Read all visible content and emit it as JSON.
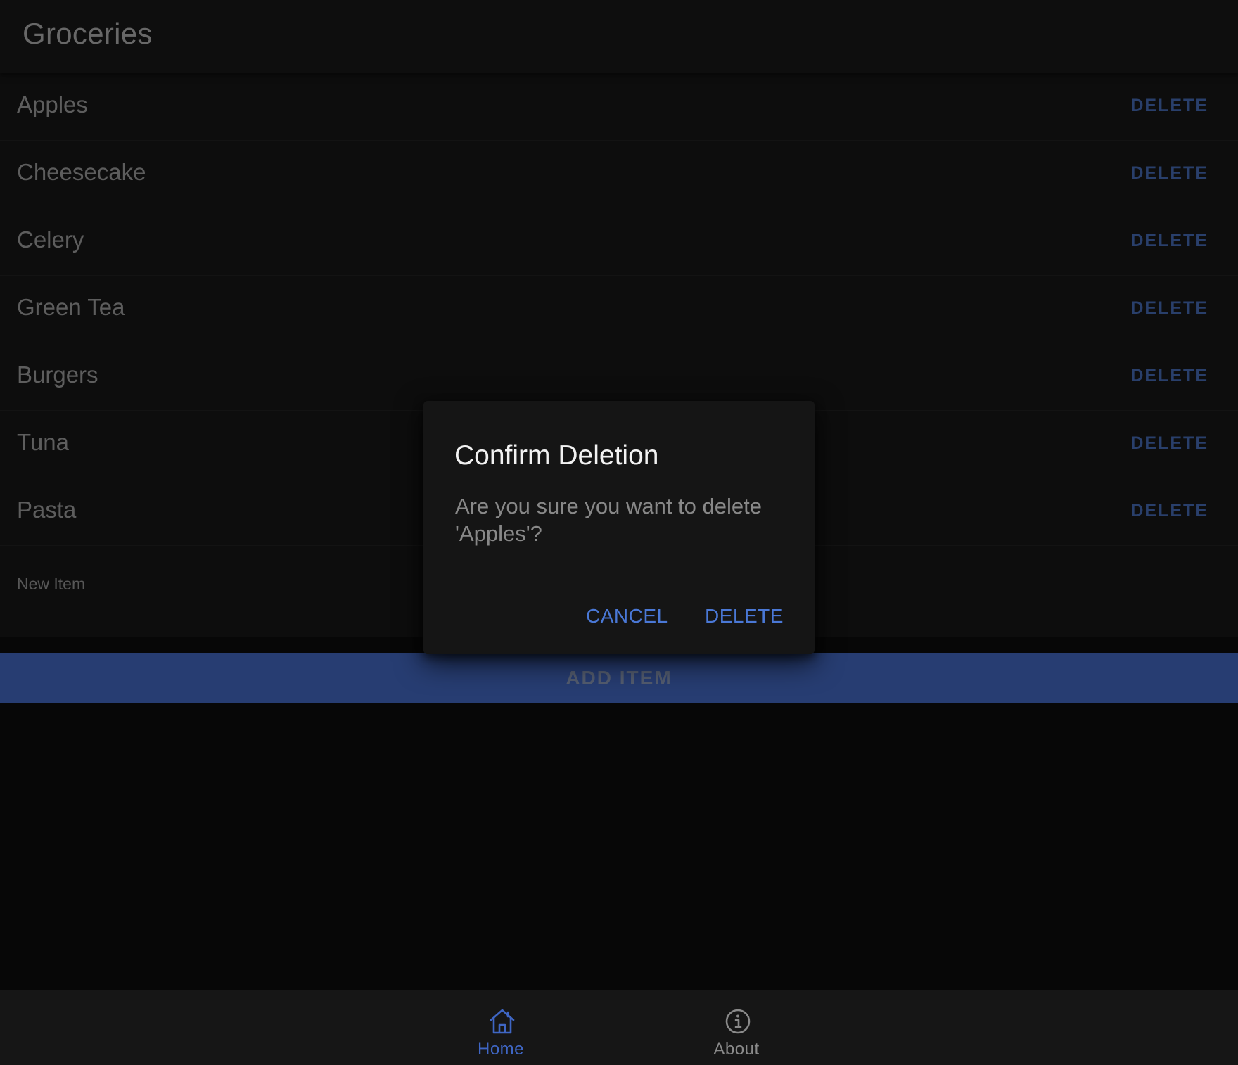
{
  "header": {
    "title": "Groceries"
  },
  "items": [
    {
      "label": "Apples",
      "action": "DELETE"
    },
    {
      "label": "Cheesecake",
      "action": "DELETE"
    },
    {
      "label": "Celery",
      "action": "DELETE"
    },
    {
      "label": "Green Tea",
      "action": "DELETE"
    },
    {
      "label": "Burgers",
      "action": "DELETE"
    },
    {
      "label": "Tuna",
      "action": "DELETE"
    },
    {
      "label": "Pasta",
      "action": "DELETE"
    }
  ],
  "new_item": {
    "placeholder": "New Item",
    "value": ""
  },
  "add_button": {
    "label": "ADD ITEM"
  },
  "dialog": {
    "title": "Confirm Deletion",
    "message": "Are you sure you want to delete 'Apples'?",
    "cancel_label": "CANCEL",
    "confirm_label": "DELETE"
  },
  "tabs": [
    {
      "label": "Home",
      "icon": "home-icon",
      "active": true
    },
    {
      "label": "About",
      "icon": "info-icon",
      "active": false
    }
  ],
  "colors": {
    "accent": "#3a5ba8",
    "link": "#4a78d6",
    "inactive_tab": "#8a8a8a"
  }
}
